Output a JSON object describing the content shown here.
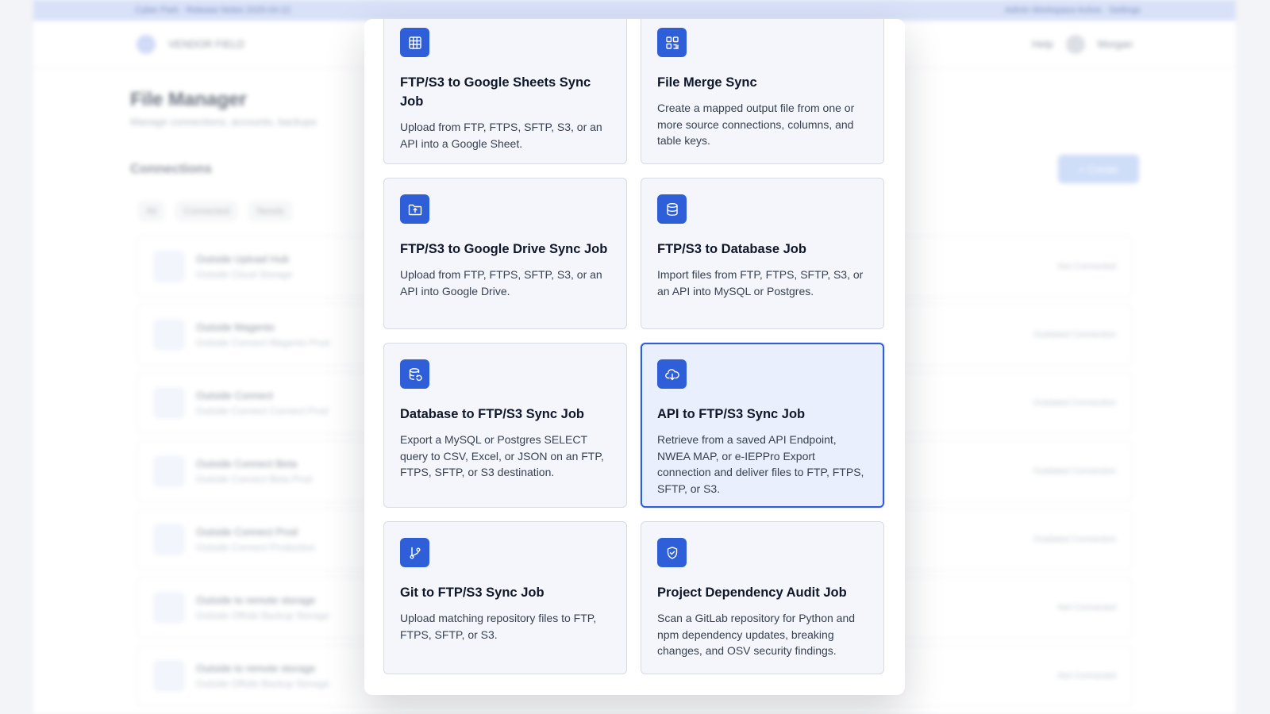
{
  "background": {
    "banner": {
      "left": "Cyber Park · Release Notes 2025-04-22",
      "right": "Admin Workspace Active · Settings"
    },
    "nav": {
      "brand": "VENDOR FIELD",
      "help": "Help",
      "user": "Morgan"
    },
    "page_title": "File Manager",
    "page_subtitle": "Manage connections, accounts, backups",
    "section_title": "Connections",
    "create_label": "+ Create",
    "filters": [
      "All",
      "Connected",
      "Needs"
    ],
    "connections": [
      {
        "name": "Outside Upload Hub",
        "desc": "Outside Cloud Storage",
        "status": "Not Connected"
      },
      {
        "name": "Outside Magento",
        "desc": "Outside Connect Magento Prod",
        "status": "Outdated Connection"
      },
      {
        "name": "Outside Connect",
        "desc": "Outside Connect Connect Prod",
        "status": "Outdated Connection"
      },
      {
        "name": "Outside Connect Beta",
        "desc": "Outside Connect Beta Prod",
        "status": "Outdated Connection"
      },
      {
        "name": "Outside Connect Prod",
        "desc": "Outside Connect Production",
        "status": "Outdated Connection"
      },
      {
        "name": "Outside to remote storage",
        "desc": "Outside Offsite Backup Storage",
        "status": "Not Connected"
      },
      {
        "name": "Outside to remote storage",
        "desc": "Outside Offsite Backup Storage",
        "status": "Not Connected"
      }
    ]
  },
  "modal": {
    "cards": [
      {
        "id": "sheets",
        "icon": "table-grid-icon",
        "title": "FTP/S3 to Google Sheets Sync Job",
        "desc": "Upload from FTP, FTPS, SFTP, S3, or an API into a Google Sheet.",
        "selected": false
      },
      {
        "id": "merge",
        "icon": "merge-blocks-icon",
        "title": "File Merge Sync",
        "desc": "Create a mapped output file from one or more source connections, columns, and table keys.",
        "selected": false
      },
      {
        "id": "drive",
        "icon": "folder-upload-icon",
        "title": "FTP/S3 to Google Drive Sync Job",
        "desc": "Upload from FTP, FTPS, SFTP, S3, or an API into Google Drive.",
        "selected": false
      },
      {
        "id": "database",
        "icon": "database-icon",
        "title": "FTP/S3 to Database Job",
        "desc": "Import files from FTP, FTPS, SFTP, S3, or an API into MySQL or Postgres.",
        "selected": false
      },
      {
        "id": "db-export",
        "icon": "database-export-icon",
        "title": "Database to FTP/S3 Sync Job",
        "desc": "Export a MySQL or Postgres SELECT query to CSV, Excel, or JSON on an FTP, FTPS, SFTP, or S3 destination.",
        "selected": false
      },
      {
        "id": "api",
        "icon": "cloud-download-icon",
        "title": "API to FTP/S3 Sync Job",
        "desc": "Retrieve from a saved API Endpoint, NWEA MAP, or e-IEPPro Export connection and deliver files to FTP, FTPS, SFTP, or S3.",
        "selected": true
      },
      {
        "id": "git",
        "icon": "git-branch-icon",
        "title": "Git to FTP/S3 Sync Job",
        "desc": "Upload matching repository files to FTP, FTPS, SFTP, or S3.",
        "selected": false
      },
      {
        "id": "audit",
        "icon": "shield-check-icon",
        "title": "Project Dependency Audit Job",
        "desc": "Scan a GitLab repository for Python and npm dependency updates, breaking changes, and OSV security findings.",
        "selected": false
      }
    ]
  }
}
